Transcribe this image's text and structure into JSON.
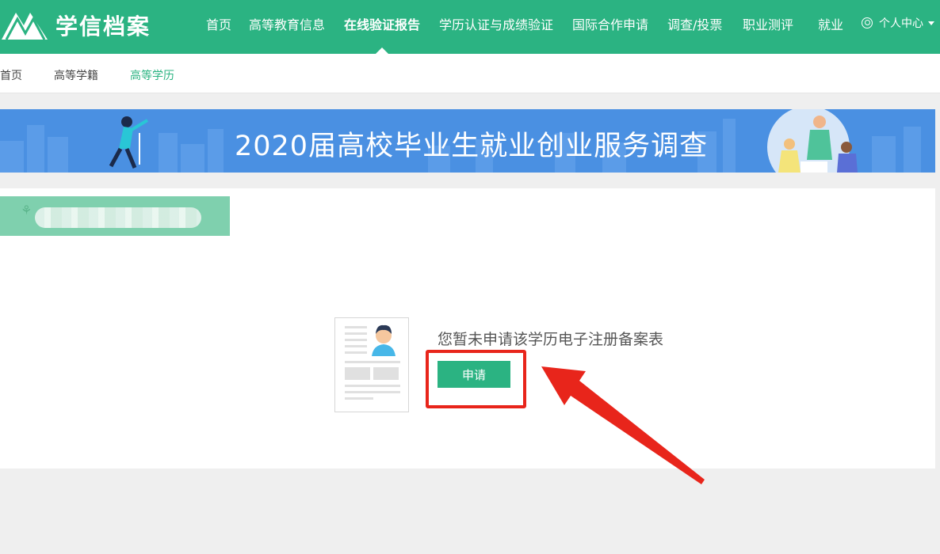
{
  "brand": {
    "logo_text": "学信档案"
  },
  "nav": {
    "items": [
      {
        "label": "首页"
      },
      {
        "label": "高等教育信息"
      },
      {
        "label": "在线验证报告"
      },
      {
        "label": "学历认证与成绩验证"
      },
      {
        "label": "国际合作申请"
      },
      {
        "label": "调查/投票"
      },
      {
        "label": "职业测评"
      },
      {
        "label": "就业"
      }
    ],
    "active": "在线验证报告",
    "user_label": "个人中心"
  },
  "breadcrumb": [
    {
      "label": "首页"
    },
    {
      "label": "高等学籍"
    },
    {
      "label": "高等学历"
    }
  ],
  "banner": {
    "text": "2020届高校毕业生就业创业服务调查"
  },
  "content": {
    "empty_message": "您暂未申请该学历电子注册备案表",
    "apply_label": "申请"
  },
  "colors": {
    "brand_green": "#2bb382",
    "banner_blue": "#4a90e2",
    "annotation_red": "#e8251b"
  }
}
